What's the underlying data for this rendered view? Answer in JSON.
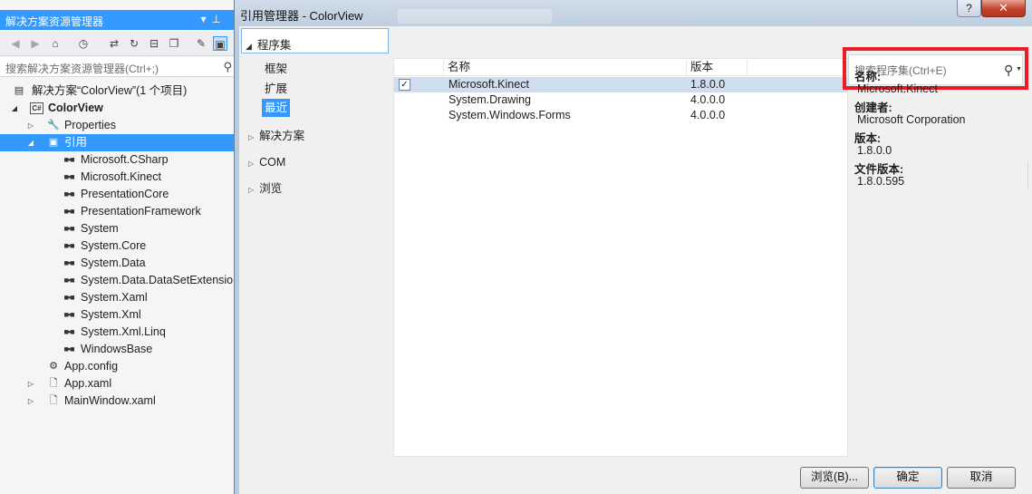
{
  "solution_explorer": {
    "title": "解决方案资源管理器",
    "search_placeholder": "搜索解决方案资源管理器(Ctrl+;)",
    "tree": [
      {
        "label": "解决方案“ColorView”(1 个项目)",
        "bold": false
      },
      {
        "label": "ColorView",
        "bold": true
      },
      {
        "label": "Properties"
      },
      {
        "label": "引用"
      },
      {
        "label": "Microsoft.CSharp"
      },
      {
        "label": "Microsoft.Kinect"
      },
      {
        "label": "PresentationCore"
      },
      {
        "label": "PresentationFramework"
      },
      {
        "label": "System"
      },
      {
        "label": "System.Core"
      },
      {
        "label": "System.Data"
      },
      {
        "label": "System.Data.DataSetExtensions"
      },
      {
        "label": "System.Xaml"
      },
      {
        "label": "System.Xml"
      },
      {
        "label": "System.Xml.Linq"
      },
      {
        "label": "WindowsBase"
      },
      {
        "label": "App.config"
      },
      {
        "label": "App.xaml"
      },
      {
        "label": "MainWindow.xaml"
      }
    ]
  },
  "dialog": {
    "title": "引用管理器 - ColorView",
    "help_label": "?",
    "close_label": "✕",
    "nav": {
      "assemblies": "程序集",
      "sub_items": [
        "框架",
        "扩展",
        "最近"
      ],
      "groups": [
        "解决方案",
        "COM",
        "浏览"
      ]
    },
    "list": {
      "columns": [
        "名称",
        "版本"
      ],
      "rows": [
        {
          "name": "Microsoft.Kinect",
          "version": "1.8.0.0",
          "checked": true
        },
        {
          "name": "System.Drawing",
          "version": "4.0.0.0",
          "checked": false
        },
        {
          "name": "System.Windows.Forms",
          "version": "4.0.0.0",
          "checked": false
        }
      ]
    },
    "search_placeholder": "搜索程序集(Ctrl+E)",
    "details": {
      "name_label": "名称:",
      "name_value": "Microsoft.Kinect",
      "creator_label": "创建者:",
      "creator_value": "Microsoft Corporation",
      "version_label": "版本:",
      "version_value": "1.8.0.0",
      "file_version_label": "文件版本:",
      "file_version_value": "1.8.0.595"
    },
    "buttons": {
      "browse": "浏览(B)...",
      "ok": "确定",
      "cancel": "取消"
    }
  },
  "colors": {
    "accent": "#3399ff",
    "highlight_box": "#ea1c24"
  }
}
